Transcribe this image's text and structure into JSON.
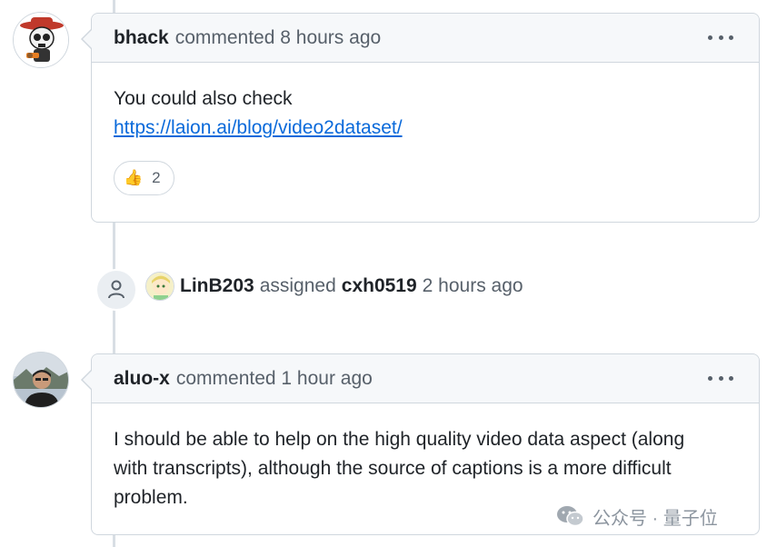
{
  "comments": [
    {
      "author": "bhack",
      "action": "commented 8 hours ago",
      "body_text": "You could also check",
      "link": "https://laion.ai/blog/video2dataset/",
      "reaction": {
        "emoji": "👍",
        "count": "2"
      }
    },
    {
      "author": "aluo-x",
      "action": "commented 1 hour ago",
      "body_text": "I should be able to help on the high quality video data aspect (along with transcripts), although the source of captions is a more difficult problem."
    }
  ],
  "event": {
    "actor": "LinB203",
    "verb": "assigned",
    "target": "cxh0519",
    "time": "2 hours ago"
  },
  "watermark": {
    "text": "公众号 · 量子位"
  },
  "icons": {
    "event": "person-icon",
    "watermark": "wechat-icon",
    "menu": "kebab-horizontal-icon"
  }
}
